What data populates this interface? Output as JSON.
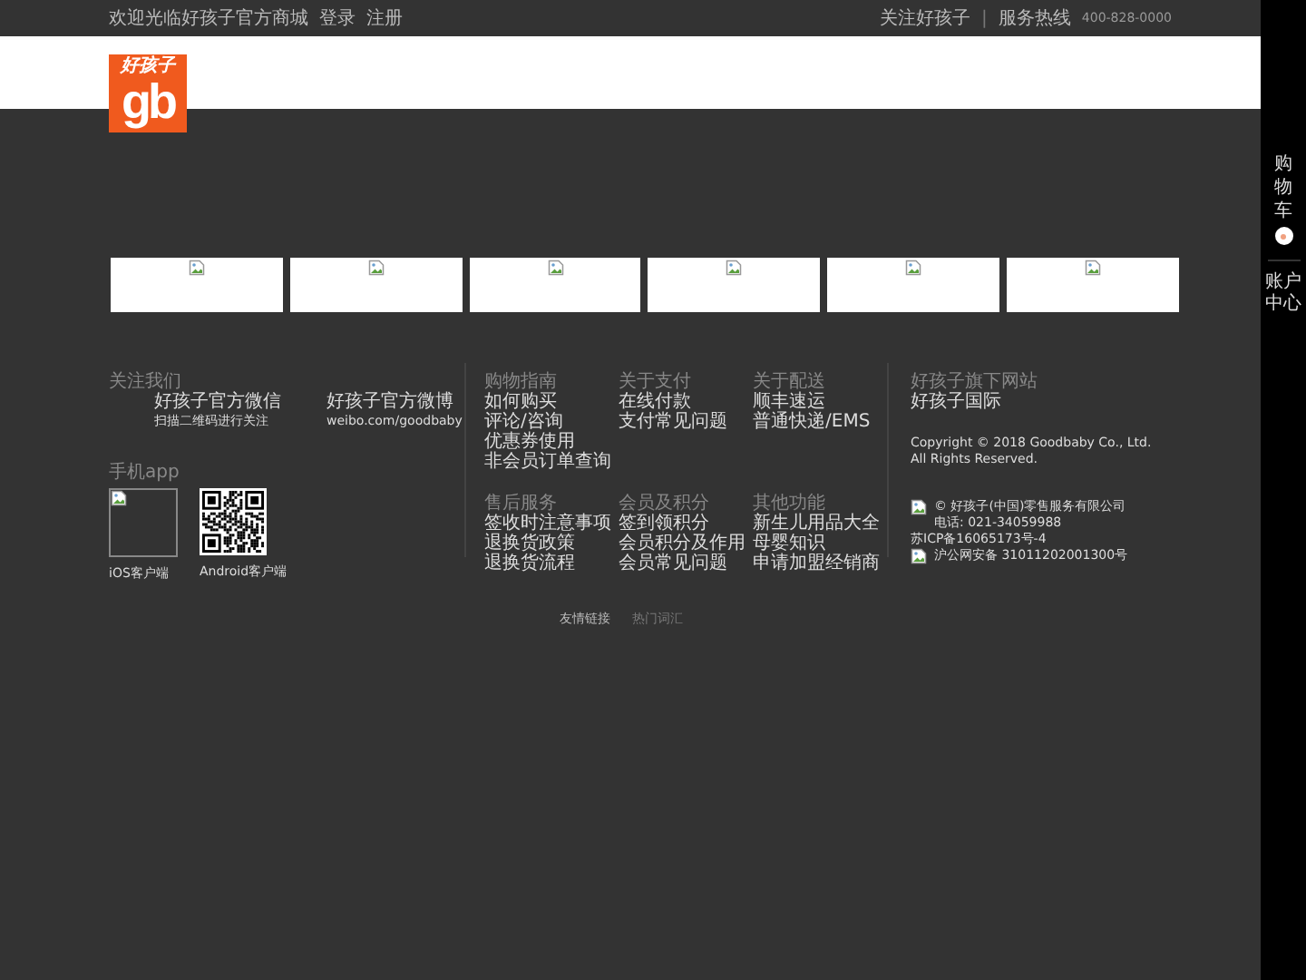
{
  "top_bar": {
    "welcome": "欢迎光临好孩子官方商城",
    "links": [
      "登录",
      "注册"
    ],
    "follow": "关注好孩子",
    "separator": "|",
    "hotline_label": "服务热线",
    "hotline": "400-828-0000"
  },
  "logo": {
    "top": "好孩子",
    "mark": "gb"
  },
  "banners": [
    {
      "kind": "broken_image"
    },
    {
      "kind": "broken_image"
    },
    {
      "kind": "broken_image"
    },
    {
      "kind": "broken_image"
    },
    {
      "kind": "broken_image"
    },
    {
      "kind": "broken_image"
    }
  ],
  "follow_us": {
    "title": "关注我们",
    "accounts": [
      {
        "name": "好孩子官方微信",
        "note": "扫描二维码进行关注"
      },
      {
        "name": "好孩子官方微博",
        "note": "weibo.com/goodbaby"
      }
    ]
  },
  "mobile_app": {
    "title": "手机app",
    "apps": [
      {
        "kind": "broken_image",
        "label": "iOS客户端"
      },
      {
        "kind": "qr_code",
        "label": "Android客户端"
      }
    ]
  },
  "help_sections": [
    {
      "title": "购物指南",
      "links": [
        "如何购买",
        "评论/咨询",
        "优惠券使用",
        "非会员订单查询"
      ]
    },
    {
      "title": "关于支付",
      "links": [
        "在线付款",
        "支付常见问题"
      ]
    },
    {
      "title": "关于配送",
      "links": [
        "顺丰速运",
        "普通快递/EMS"
      ]
    },
    {
      "title": "售后服务",
      "links": [
        "签收时注意事项",
        "退换货政策",
        "退换货流程"
      ]
    },
    {
      "title": "会员及积分",
      "links": [
        "签到领积分",
        "会员积分及作用",
        "会员常见问题"
      ]
    },
    {
      "title": "其他功能",
      "links": [
        "新生儿用品大全",
        "母婴知识",
        "申请加盟经销商"
      ]
    }
  ],
  "sites": {
    "title": "好孩子旗下网站",
    "links": [
      "好孩子国际"
    ]
  },
  "copyright": [
    "Copyright © 2018 Goodbaby Co., Ltd.",
    "All Rights Reserved."
  ],
  "company": [
    {
      "kind": "icon_line",
      "text": "© 好孩子(中国)零售服务有限公司"
    },
    {
      "kind": "indented",
      "text": "电话: 021-34059988"
    },
    {
      "kind": "plain",
      "text": "苏ICP备16065173号-4"
    },
    {
      "kind": "icon_line",
      "text": "沪公网安备 31011202001300号"
    }
  ],
  "bottom_links": [
    {
      "label": "友情链接",
      "selected": true
    },
    {
      "label": "热门词汇",
      "selected": false
    }
  ],
  "sidebar": {
    "cart": "购物车",
    "account": "账户中心"
  }
}
